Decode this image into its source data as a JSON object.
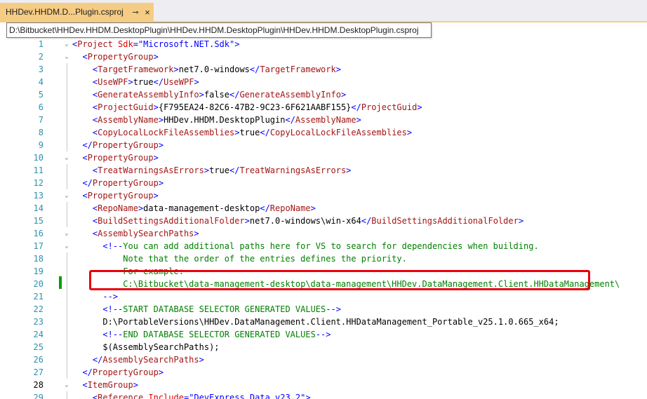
{
  "tab": {
    "title": "HHDev.HHDM.D...Plugin.csproj",
    "pin_glyph": "⊸",
    "close_glyph": "×"
  },
  "tooltip": {
    "path": "D:\\Bitbucket\\HHDev.HHDM.DesktopPlugin\\HHDev.HHDM.DesktopPlugin\\HHDev.HHDM.DesktopPlugin.csproj"
  },
  "colors": {
    "tab_active": "#f5cc84",
    "line_number": "#2b91af",
    "tag": "#a31515",
    "punctuation": "#0000ff",
    "attribute": "#e50000",
    "comment": "#008000",
    "highlight_box": "#e8000b",
    "change_bar": "#00a000"
  },
  "editor": {
    "current_line": 28,
    "highlighted_line": 23,
    "lines": [
      {
        "n": 1,
        "fold": "⌄",
        "tokens": [
          [
            "p",
            "<"
          ],
          [
            "t",
            "Project"
          ],
          [
            "",
            ""
          ],
          [
            "a",
            " Sdk"
          ],
          [
            "p",
            "="
          ],
          [
            "v",
            "\"Microsoft.NET.Sdk\""
          ],
          [
            "p",
            ">"
          ]
        ]
      },
      {
        "n": 2,
        "fold": "⌄",
        "tokens": [
          [
            "",
            "  "
          ],
          [
            "p",
            "<"
          ],
          [
            "t",
            "PropertyGroup"
          ],
          [
            "p",
            ">"
          ]
        ]
      },
      {
        "n": 3,
        "fold": "",
        "tokens": [
          [
            "",
            "    "
          ],
          [
            "p",
            "<"
          ],
          [
            "t",
            "TargetFramework"
          ],
          [
            "p",
            ">"
          ],
          [
            "",
            "net7.0-windows"
          ],
          [
            "p",
            "</"
          ],
          [
            "t",
            "TargetFramework"
          ],
          [
            "p",
            ">"
          ]
        ]
      },
      {
        "n": 4,
        "fold": "",
        "tokens": [
          [
            "",
            "    "
          ],
          [
            "p",
            "<"
          ],
          [
            "t",
            "UseWPF"
          ],
          [
            "p",
            ">"
          ],
          [
            "",
            "true"
          ],
          [
            "p",
            "</"
          ],
          [
            "t",
            "UseWPF"
          ],
          [
            "p",
            ">"
          ]
        ]
      },
      {
        "n": 5,
        "fold": "",
        "tokens": [
          [
            "",
            "    "
          ],
          [
            "p",
            "<"
          ],
          [
            "t",
            "GenerateAssemblyInfo"
          ],
          [
            "p",
            ">"
          ],
          [
            "",
            "false"
          ],
          [
            "p",
            "</"
          ],
          [
            "t",
            "GenerateAssemblyInfo"
          ],
          [
            "p",
            ">"
          ]
        ]
      },
      {
        "n": 6,
        "fold": "",
        "tokens": [
          [
            "",
            "    "
          ],
          [
            "p",
            "<"
          ],
          [
            "t",
            "ProjectGuid"
          ],
          [
            "p",
            ">"
          ],
          [
            "",
            "{F795EA24-82C6-47B2-9C23-6F621AABF155}"
          ],
          [
            "p",
            "</"
          ],
          [
            "t",
            "ProjectGuid"
          ],
          [
            "p",
            ">"
          ]
        ]
      },
      {
        "n": 7,
        "fold": "",
        "tokens": [
          [
            "",
            "    "
          ],
          [
            "p",
            "<"
          ],
          [
            "t",
            "AssemblyName"
          ],
          [
            "p",
            ">"
          ],
          [
            "",
            "HHDev.HHDM.DesktopPlugin"
          ],
          [
            "p",
            "</"
          ],
          [
            "t",
            "AssemblyName"
          ],
          [
            "p",
            ">"
          ]
        ]
      },
      {
        "n": 8,
        "fold": "",
        "tokens": [
          [
            "",
            "    "
          ],
          [
            "p",
            "<"
          ],
          [
            "t",
            "CopyLocalLockFileAssemblies"
          ],
          [
            "p",
            ">"
          ],
          [
            "",
            "true"
          ],
          [
            "p",
            "</"
          ],
          [
            "t",
            "CopyLocalLockFileAssemblies"
          ],
          [
            "p",
            ">"
          ]
        ]
      },
      {
        "n": 9,
        "fold": "",
        "tokens": [
          [
            "",
            "  "
          ],
          [
            "p",
            "</"
          ],
          [
            "t",
            "PropertyGroup"
          ],
          [
            "p",
            ">"
          ]
        ]
      },
      {
        "n": 10,
        "fold": "⌄",
        "tokens": [
          [
            "",
            "  "
          ],
          [
            "p",
            "<"
          ],
          [
            "t",
            "PropertyGroup"
          ],
          [
            "p",
            ">"
          ]
        ]
      },
      {
        "n": 11,
        "fold": "",
        "tokens": [
          [
            "",
            "    "
          ],
          [
            "p",
            "<"
          ],
          [
            "t",
            "TreatWarningsAsErrors"
          ],
          [
            "p",
            ">"
          ],
          [
            "",
            "true"
          ],
          [
            "p",
            "</"
          ],
          [
            "t",
            "TreatWarningsAsErrors"
          ],
          [
            "p",
            ">"
          ]
        ]
      },
      {
        "n": 12,
        "fold": "",
        "tokens": [
          [
            "",
            "  "
          ],
          [
            "p",
            "</"
          ],
          [
            "t",
            "PropertyGroup"
          ],
          [
            "p",
            ">"
          ]
        ]
      },
      {
        "n": 13,
        "fold": "⌄",
        "tokens": [
          [
            "",
            "  "
          ],
          [
            "p",
            "<"
          ],
          [
            "t",
            "PropertyGroup"
          ],
          [
            "p",
            ">"
          ]
        ]
      },
      {
        "n": 14,
        "fold": "",
        "tokens": [
          [
            "",
            "    "
          ],
          [
            "p",
            "<"
          ],
          [
            "t",
            "RepoName"
          ],
          [
            "p",
            ">"
          ],
          [
            "",
            "data-management-desktop"
          ],
          [
            "p",
            "</"
          ],
          [
            "t",
            "RepoName"
          ],
          [
            "p",
            ">"
          ]
        ]
      },
      {
        "n": 15,
        "fold": "",
        "tokens": [
          [
            "",
            "    "
          ],
          [
            "p",
            "<"
          ],
          [
            "t",
            "BuildSettingsAdditionalFolder"
          ],
          [
            "p",
            ">"
          ],
          [
            "",
            "net7.0-windows\\win-x64"
          ],
          [
            "p",
            "</"
          ],
          [
            "t",
            "BuildSettingsAdditionalFolder"
          ],
          [
            "p",
            ">"
          ]
        ]
      },
      {
        "n": 16,
        "fold": "⌄",
        "tokens": [
          [
            "",
            "    "
          ],
          [
            "p",
            "<"
          ],
          [
            "t",
            "AssemblySearchPaths"
          ],
          [
            "p",
            ">"
          ]
        ]
      },
      {
        "n": 17,
        "fold": "⌄",
        "tokens": [
          [
            "",
            "      "
          ],
          [
            "p",
            "<!--"
          ],
          [
            "c",
            "You can add additional paths here for VS to search for dependencies when building."
          ]
        ]
      },
      {
        "n": 18,
        "fold": "",
        "tokens": [
          [
            "c",
            "          Note that the order of the entries defines the priority."
          ]
        ]
      },
      {
        "n": 19,
        "fold": "",
        "tokens": [
          [
            "c",
            "          For example:"
          ]
        ]
      },
      {
        "n": 20,
        "fold": "",
        "tokens": [
          [
            "c",
            "          C:\\Bitbucket\\data-management-desktop\\data-management\\HHDev.DataManagement.Client.HHDataManagement\\"
          ]
        ]
      },
      {
        "n": 21,
        "fold": "",
        "tokens": [
          [
            "",
            "      "
          ],
          [
            "p",
            "-->"
          ]
        ]
      },
      {
        "n": 22,
        "fold": "",
        "tokens": [
          [
            "",
            "      "
          ],
          [
            "p",
            "<!--"
          ],
          [
            "c",
            "START DATABASE SELECTOR GENERATED VALUES"
          ],
          [
            "p",
            "-->"
          ]
        ]
      },
      {
        "n": 23,
        "fold": "",
        "tokens": [
          [
            "",
            "      D:\\PortableVersions\\HHDev.DataManagement.Client.HHDataManagement_Portable_v25.1.0.665_x64;"
          ]
        ]
      },
      {
        "n": 24,
        "fold": "",
        "tokens": [
          [
            "",
            "      "
          ],
          [
            "p",
            "<!--"
          ],
          [
            "c",
            "END DATABASE SELECTOR GENERATED VALUES"
          ],
          [
            "p",
            "-->"
          ]
        ]
      },
      {
        "n": 25,
        "fold": "",
        "tokens": [
          [
            "",
            "      $(AssemblySearchPaths);"
          ]
        ]
      },
      {
        "n": 26,
        "fold": "",
        "tokens": [
          [
            "",
            "    "
          ],
          [
            "p",
            "</"
          ],
          [
            "t",
            "AssemblySearchPaths"
          ],
          [
            "p",
            ">"
          ]
        ]
      },
      {
        "n": 27,
        "fold": "",
        "tokens": [
          [
            "",
            "  "
          ],
          [
            "p",
            "</"
          ],
          [
            "t",
            "PropertyGroup"
          ],
          [
            "p",
            ">"
          ]
        ]
      },
      {
        "n": 28,
        "fold": "⌄",
        "tokens": [
          [
            "",
            "  "
          ],
          [
            "p",
            "<"
          ],
          [
            "t",
            "ItemGroup"
          ],
          [
            "p",
            ">"
          ]
        ]
      },
      {
        "n": 29,
        "fold": "",
        "tokens": [
          [
            "",
            "    "
          ],
          [
            "p",
            "<"
          ],
          [
            "t",
            "Reference"
          ],
          [
            "a",
            " Include"
          ],
          [
            "p",
            "="
          ],
          [
            "v",
            "\"DevExpress.Data.v23.2\""
          ],
          [
            "p",
            ">"
          ]
        ]
      }
    ]
  }
}
